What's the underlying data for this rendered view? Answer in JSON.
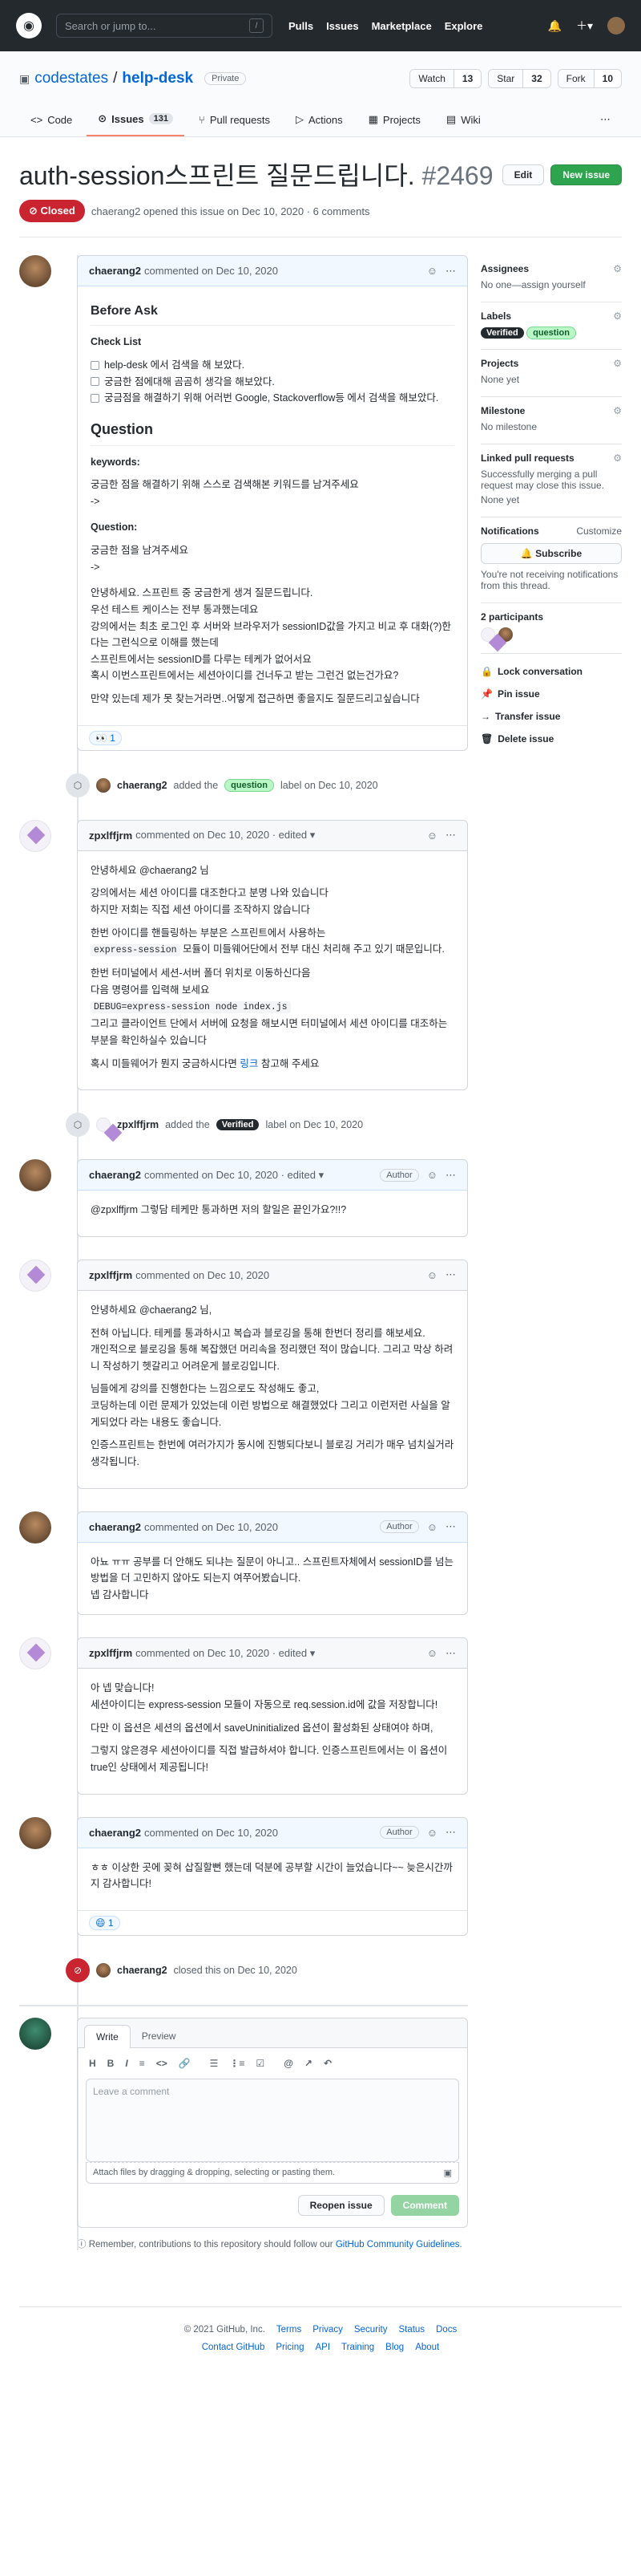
{
  "header": {
    "search_placeholder": "Search or jump to...",
    "search_key": "/",
    "nav": [
      "Pulls",
      "Issues",
      "Marketplace",
      "Explore"
    ]
  },
  "repo": {
    "owner": "codestates",
    "name": "help-desk",
    "visibility": "Private",
    "watch": "Watch",
    "watch_count": "13",
    "star": "Star",
    "star_count": "32",
    "fork": "Fork",
    "fork_count": "10"
  },
  "tabs": [
    {
      "label": "Code"
    },
    {
      "label": "Issues",
      "count": "131"
    },
    {
      "label": "Pull requests"
    },
    {
      "label": "Actions"
    },
    {
      "label": "Projects"
    },
    {
      "label": "Wiki"
    }
  ],
  "issue": {
    "title": "auth-session스프린트 질문드립니다.",
    "number": "#2469",
    "edit": "Edit",
    "new_issue": "New issue",
    "state": "Closed",
    "meta": "chaerang2 opened this issue on Dec 10, 2020 · 6 comments"
  },
  "c1": {
    "author": "chaerang2",
    "when": "commented on Dec 10, 2020",
    "h_before": "Before Ask",
    "h_check": "Check List",
    "checks": [
      "help-desk 에서 검색을 해 보았다.",
      "궁금한 점에대해 곰곰히 생각을 해보았다.",
      "궁금점을 해결하기 위해 어러번 Google, Stackoverflow등 에서 검색을 해보았다."
    ],
    "h_question": "Question",
    "kw_label": "keywords:",
    "kw_text": "궁금한 점을 해결하기 위해 스스로 검색해본 키워드를 남겨주세요",
    "arrow1": "->",
    "q_label": "Question:",
    "q_text": "궁금한 점을 남겨주세요",
    "arrow2": "->",
    "body1": "안녕하세요. 스프린트 중 궁금한게 생겨 질문드립니다.",
    "body2": "우선 테스트 케이스는 전부 통과했는데요",
    "body3": "강의에서는 최초 로그인 후 서버와 브라우저가 sessionID값을 가지고 비교 후 대화(?)한다는 그런식으로 이해를 했는데",
    "body4": "스프린트에서는 sessionID를 다루는 테케가 없어서요",
    "body5": "혹시 이번스프린트에서는 세션아이디를 건너두고 받는 그런건 없는건가요?",
    "body6": "만약 있는데 제가 못 찾는거라면..어떻게 접근하면 좋을지도 질문드리고싶습니다",
    "reaction": "👀 1"
  },
  "e1": {
    "user": "chaerang2",
    "action": "added the",
    "label": "question",
    "suffix": "label on Dec 10, 2020"
  },
  "c2": {
    "author": "zpxlffjrm",
    "when": "commented on Dec 10, 2020 · edited ▾",
    "l1": "안녕하세요 @chaerang2 님",
    "l2": "강의에서는 세션 아이디를 대조한다고 분명 나와 있습니다",
    "l3": "하지만 저희는 직접 세션 아이디를 조작하지 않습니다",
    "l4": "한번 아이디를 핸들링하는 부분은 스프린트에서 사용하는",
    "code1": "express-session",
    "l5": "모듈이 미들웨어단에서 전부 대신 처리해 주고 있기 때문입니다.",
    "l6": "한번 터미널에서 세션-서버 폴더 위치로 이동하신다음",
    "l7": "다음 명령어를 입력해 보세요",
    "code2": "DEBUG=express-session node index.js",
    "l8": "그리고 클라이언트 단에서 서버에 요청을 해보시면 터미널에서 세션 아이디를 대조하는 부분을 확인하실수 있습니다",
    "l9": "혹시 미들웨어가 뭔지 궁금하시다면",
    "link": "링크",
    "l9b": "참고해 주세요"
  },
  "e2": {
    "user": "zpxlffjrm",
    "action": "added the",
    "label": "Verified",
    "suffix": "label on Dec 10, 2020"
  },
  "c3": {
    "author": "chaerang2",
    "when": "commented on Dec 10, 2020 · edited ▾",
    "badge": "Author",
    "text": "@zpxlffjrm 그렇담 테케만 통과하면 저의 할일은 끝인가요?!!?"
  },
  "c4": {
    "author": "zpxlffjrm",
    "when": "commented on Dec 10, 2020",
    "l1": "안녕하세요 @chaerang2 님,",
    "l2": "전혀 아닙니다. 테케를 통과하시고 복습과 블로깅을 통해 한번더 정리를 해보세요.",
    "l3": "개인적으로 블로깅을 통해 복잡했던 머리속을 정리했던 적이 많습니다. 그리고 막상 하려니 작성하기 헷갈리고 어려운게 블로깅입니다.",
    "l4": "님들에게 강의를 진행한다는 느낌으로도 작성해도 좋고,",
    "l5": "코딩하는데 이런 문제가 있었는데 이런 방법으로 해결했었다 그리고 이런저런 사실을 알게되었다 라는 내용도 좋습니다.",
    "l6": "인증스프린트는 한번에 여러가지가 동시에 진행되다보니 블로깅 거리가 매우 넘치실거라 생각됩니다."
  },
  "c5": {
    "author": "chaerang2",
    "when": "commented on Dec 10, 2020",
    "badge": "Author",
    "text": "아뇨 ㅠㅠ 공부를 더 안해도 되냐는 질문이 아니고.. 스프린트자체에서 sessionID를 넘는 방법을 더 고민하지 않아도 되는지 여쭈어봤습니다.",
    "thanks": "넵 감사합니다"
  },
  "c6": {
    "author": "zpxlffjrm",
    "when": "commented on Dec 10, 2020 · edited ▾",
    "l1": "아 넵 맞습니다!",
    "l2": "세션아이디는 express-session 모듈이 자동으로 req.session.id에 값을 저장합니다!",
    "l3": "다만 이 옵션은 세션의 옵션에서 saveUninitialized 옵션이 활성화된 상태여야 하며,",
    "l4": "그렇지 않은경우 세션아이디를 직접 발급하셔야 합니다. 인증스프린트에서는 이 옵션이 true인 상태에서 제공됩니다!"
  },
  "c7": {
    "author": "chaerang2",
    "when": "commented on Dec 10, 2020",
    "badge": "Author",
    "text": "ㅎㅎ 이상한 곳에 꽂혀 삽질할뻔 했는데 덕분에 공부할 시간이 늘었습니다~~ 늦은시간까지 감사합니다!",
    "reaction": "😄 1"
  },
  "e3": {
    "user": "chaerang2",
    "text": "closed this on Dec 10, 2020"
  },
  "composer": {
    "write": "Write",
    "preview": "Preview",
    "tools": [
      "H",
      "B",
      "I",
      "≡",
      "<>",
      "🔗",
      "☰",
      "⋮≡",
      "☑",
      "@",
      "↗",
      "↶"
    ],
    "placeholder": "Leave a comment",
    "attach": "Attach files by dragging & dropping, selecting or pasting them.",
    "reopen": "Reopen issue",
    "comment": "Comment",
    "note_pre": "Remember, contributions to this repository should follow our",
    "note_link": "GitHub Community Guidelines",
    "note_post": "."
  },
  "sidebar": {
    "assignees": "Assignees",
    "assignees_val": "No one—assign yourself",
    "labels": "Labels",
    "label1": "Verified",
    "label2": "question",
    "projects": "Projects",
    "projects_val": "None yet",
    "milestone": "Milestone",
    "milestone_val": "No milestone",
    "linked": "Linked pull requests",
    "linked_val": "Successfully merging a pull request may close this issue.",
    "linked_val2": "None yet",
    "notifications": "Notifications",
    "customize": "Customize",
    "subscribe": "Subscribe",
    "notif_text": "You're not receiving notifications from this thread.",
    "participants": "2 participants",
    "lock": "Lock conversation",
    "pin": "Pin issue",
    "transfer": "Transfer issue",
    "delete": "Delete issue"
  },
  "footer": {
    "copy": "© 2021 GitHub, Inc.",
    "row1": [
      "Terms",
      "Privacy",
      "Security",
      "Status",
      "Docs"
    ],
    "row2": [
      "Contact GitHub",
      "Pricing",
      "API",
      "Training",
      "Blog",
      "About"
    ]
  }
}
